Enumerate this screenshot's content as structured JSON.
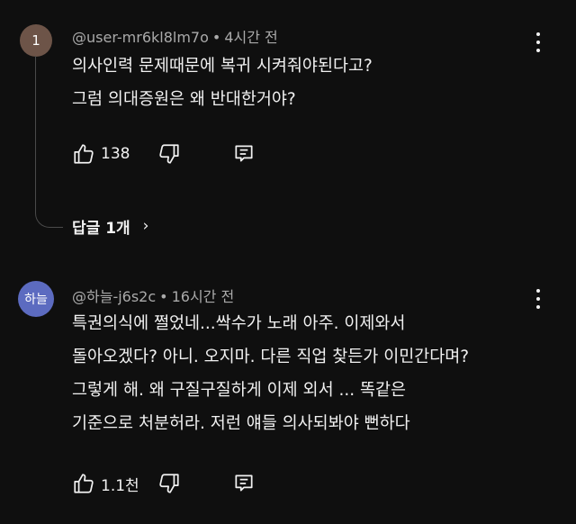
{
  "comments": [
    {
      "avatar_text": "1",
      "avatar_color": "#6d5448",
      "username": "@user-mr6kl8lm7o",
      "separator": "•",
      "time": "4시간 전",
      "lines": [
        "의사인력 문제때문에 복귀 시켜줘야된다고?",
        "그럼 의대증원은 왜 반대한거야?"
      ],
      "likes": "138",
      "replies_label": "답글 1개",
      "replies_chevron": "›"
    },
    {
      "avatar_text": "하늘",
      "avatar_color": "#5c6bc0",
      "username": "@하늘-j6s2c",
      "separator": "•",
      "time": "16시간 전",
      "lines": [
        "특권의식에 쩔었네...싹수가 노래 아주. 이제와서",
        "돌아오겠다? 아니. 오지마. 다른 직업 찾든가 이민간다며?",
        "그렇게 해. 왜 구질구질하게 이제 외서 ... 똑같은",
        "기준으로 처분허라. 저런 얘들 의사되봐야 뻔하다"
      ],
      "likes": "1.1천"
    }
  ],
  "icons": {
    "like": "thumbs-up-icon",
    "dislike": "thumbs-down-icon",
    "reply": "reply-icon",
    "menu": "more-vert-icon"
  }
}
